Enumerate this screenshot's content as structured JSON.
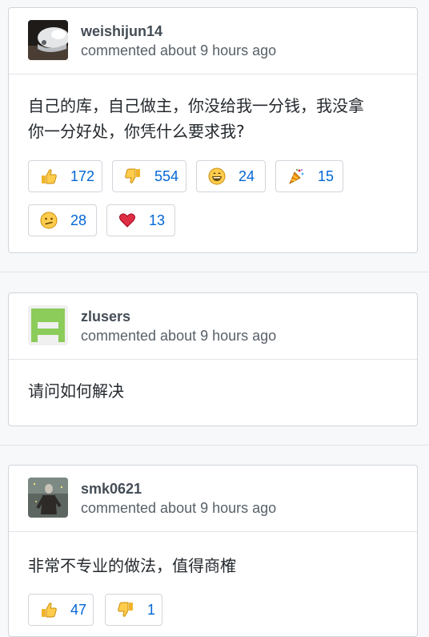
{
  "comments": [
    {
      "author": "weishijun14",
      "meta": "commented about 9 hours ago",
      "body_line1": "自己的库，自己做主，你没给我一分钱，我没拿",
      "body_line2": "你一分好处，你凭什么要求我?",
      "reactions": [
        {
          "icon": "thumbs-up-icon",
          "count": "172"
        },
        {
          "icon": "thumbs-down-icon",
          "count": "554"
        },
        {
          "icon": "laugh-icon",
          "count": "24"
        },
        {
          "icon": "hooray-icon",
          "count": "15"
        },
        {
          "icon": "confused-icon",
          "count": "28"
        },
        {
          "icon": "heart-icon",
          "count": "13"
        }
      ]
    },
    {
      "author": "zlusers",
      "meta": "commented about 9 hours ago",
      "body_line1": "请问如何解决"
    },
    {
      "author": "smk0621",
      "meta": "commented about 9 hours ago",
      "body_line1": "非常不专业的做法，值得商榷",
      "reactions": [
        {
          "icon": "thumbs-up-icon",
          "count": "47"
        },
        {
          "icon": "thumbs-down-icon",
          "count": "1"
        }
      ]
    }
  ],
  "colors": {
    "link": "#0366d6",
    "border": "#d1d5da",
    "background": "#f6f8fa",
    "identicon": "#8ccc5a"
  }
}
